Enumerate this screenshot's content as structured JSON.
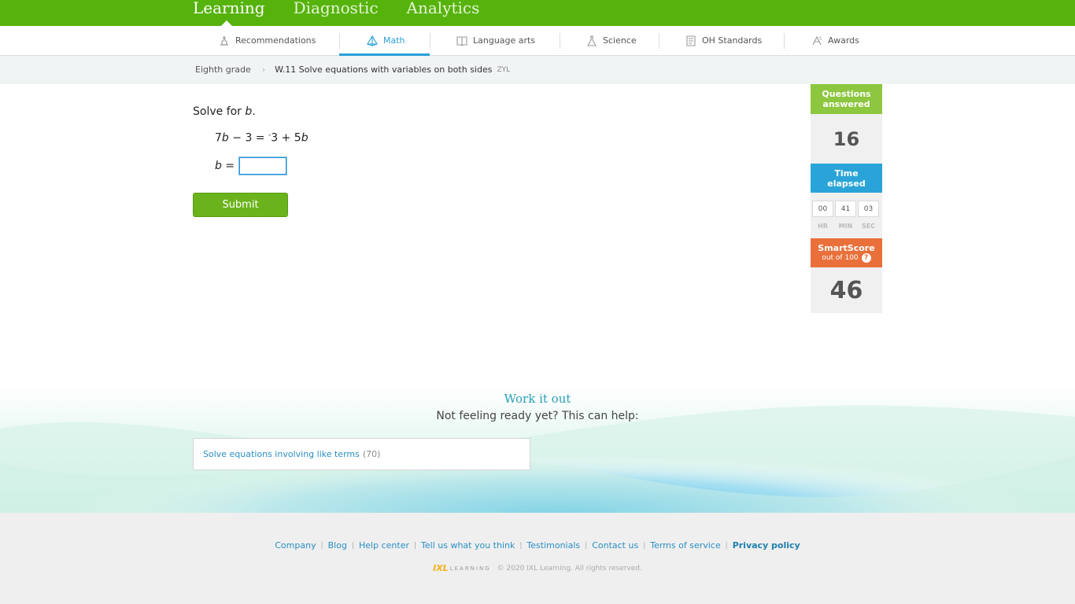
{
  "topnav": {
    "items": [
      {
        "label": "Learning"
      },
      {
        "label": "Diagnostic"
      },
      {
        "label": "Analytics"
      }
    ]
  },
  "subjects": {
    "tabs": [
      {
        "label": "Recommendations",
        "icon": "recommendations-icon"
      },
      {
        "label": "Math",
        "icon": "pyramid-icon",
        "active": true
      },
      {
        "label": "Language arts",
        "icon": "book-icon"
      },
      {
        "label": "Science",
        "icon": "flask-icon"
      },
      {
        "label": "OH Standards",
        "icon": "standards-icon"
      },
      {
        "label": "Awards",
        "icon": "awards-icon"
      }
    ],
    "accent": "#2a9fd6"
  },
  "breadcrumb": {
    "grade": "Eighth grade",
    "skill": "W.11 Solve equations with variables on both sides",
    "code": "ZYL"
  },
  "question": {
    "prompt_prefix": "Solve for ",
    "prompt_var": "b",
    "prompt_suffix": ".",
    "equation": {
      "coef1": "7",
      "var1": "b",
      "mid": " − 3 = ",
      "neg": "-",
      "mid2": "3 + 5",
      "var2": "b"
    },
    "answer_var": "b",
    "answer_eq": " =",
    "answer_value": "",
    "submit_label": "Submit"
  },
  "stats": {
    "questions_answered_label_1": "Questions",
    "questions_answered_label_2": "answered",
    "questions_answered": "16",
    "time_elapsed_label_1": "Time",
    "time_elapsed_label_2": "elapsed",
    "hours": "00",
    "minutes": "41",
    "seconds": "03",
    "hr_label": "HR",
    "min_label": "MIN",
    "sec_label": "SEC",
    "smartscore_label": "SmartScore",
    "smartscore_sub": "out of 100",
    "smartscore_help": "?",
    "smartscore": "46",
    "colors": {
      "answered": "#8dc63f",
      "time": "#2aa4d8",
      "smartscore": "#e9703b"
    }
  },
  "work_it_out": {
    "title": "Work it out",
    "subtitle": "Not feeling ready yet? This can help:",
    "link_label": "Solve equations involving like terms",
    "link_count": "(70)"
  },
  "footer": {
    "links": [
      {
        "label": "Company"
      },
      {
        "label": "Blog"
      },
      {
        "label": "Help center"
      },
      {
        "label": "Tell us what you think"
      },
      {
        "label": "Testimonials"
      },
      {
        "label": "Contact us"
      },
      {
        "label": "Terms of service"
      },
      {
        "label": "Privacy policy",
        "bold": true
      }
    ],
    "logo_mark": "IXL",
    "logo_word": "LEARNING",
    "copyright": "© 2020 IXL Learning. All rights reserved."
  }
}
